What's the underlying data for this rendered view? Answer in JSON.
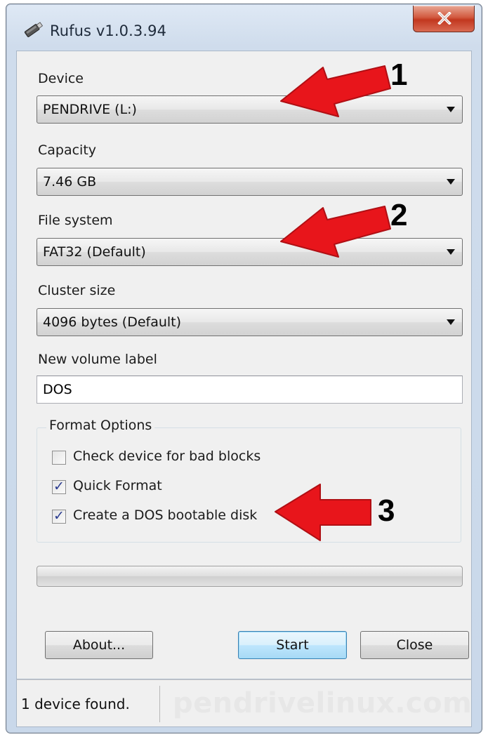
{
  "window": {
    "title": "Rufus v1.0.3.94",
    "app_icon": "usb-drive-icon",
    "close_icon": "close-icon",
    "close_color": "#c7402a"
  },
  "device": {
    "label": "Device",
    "value": "PENDRIVE (L:)"
  },
  "capacity": {
    "label": "Capacity",
    "value": "7.46 GB"
  },
  "file_system": {
    "label": "File system",
    "value": "FAT32 (Default)"
  },
  "cluster_size": {
    "label": "Cluster size",
    "value": "4096 bytes (Default)"
  },
  "volume_label": {
    "label": "New volume label",
    "value": "DOS"
  },
  "format_options": {
    "title": "Format Options",
    "options": [
      {
        "label": "Check device for bad blocks",
        "checked": false
      },
      {
        "label": "Quick Format",
        "checked": true
      },
      {
        "label": "Create a DOS bootable disk",
        "checked": true
      }
    ]
  },
  "progress": {
    "value": 0
  },
  "buttons": {
    "about": "About...",
    "start": "Start",
    "close": "Close"
  },
  "status": {
    "text": "1 device found.",
    "watermark": "pendrivelinux.com"
  },
  "annotations": {
    "color": "#e8151b",
    "markers": [
      "1",
      "2",
      "3"
    ]
  }
}
